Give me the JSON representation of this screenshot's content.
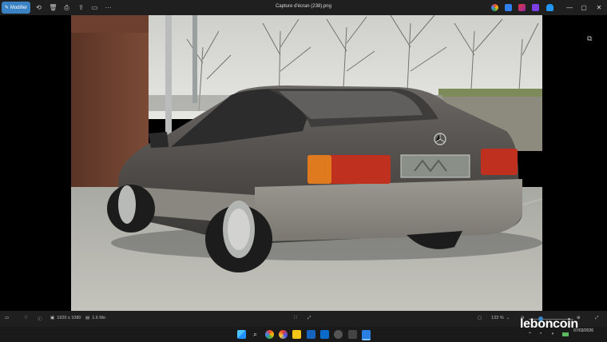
{
  "window": {
    "title": "Capture d'écran (238).png"
  },
  "toolbar": {
    "edit_label": "Modifier",
    "more_label": "···"
  },
  "window_controls": {
    "minimize": "—",
    "maximize": "▢",
    "close": "✕"
  },
  "statusbar": {
    "dimensions": "1920 x 1080",
    "file_size": "1.6 Mo",
    "zoom": "133 %"
  },
  "watermark": {
    "brand": "leboncoin"
  },
  "clock": {
    "date": "07/03/2026"
  },
  "colors": {
    "accent": "#3b82c4",
    "titlebar": "#1f1f1f",
    "taskbar": "#1a1a1a"
  },
  "icons": [
    "rotate-icon",
    "delete-icon",
    "favorite-icon",
    "crop-icon",
    "share-icon",
    "info-icon",
    "fit-icon",
    "search-icon",
    "windows-start-icon"
  ]
}
